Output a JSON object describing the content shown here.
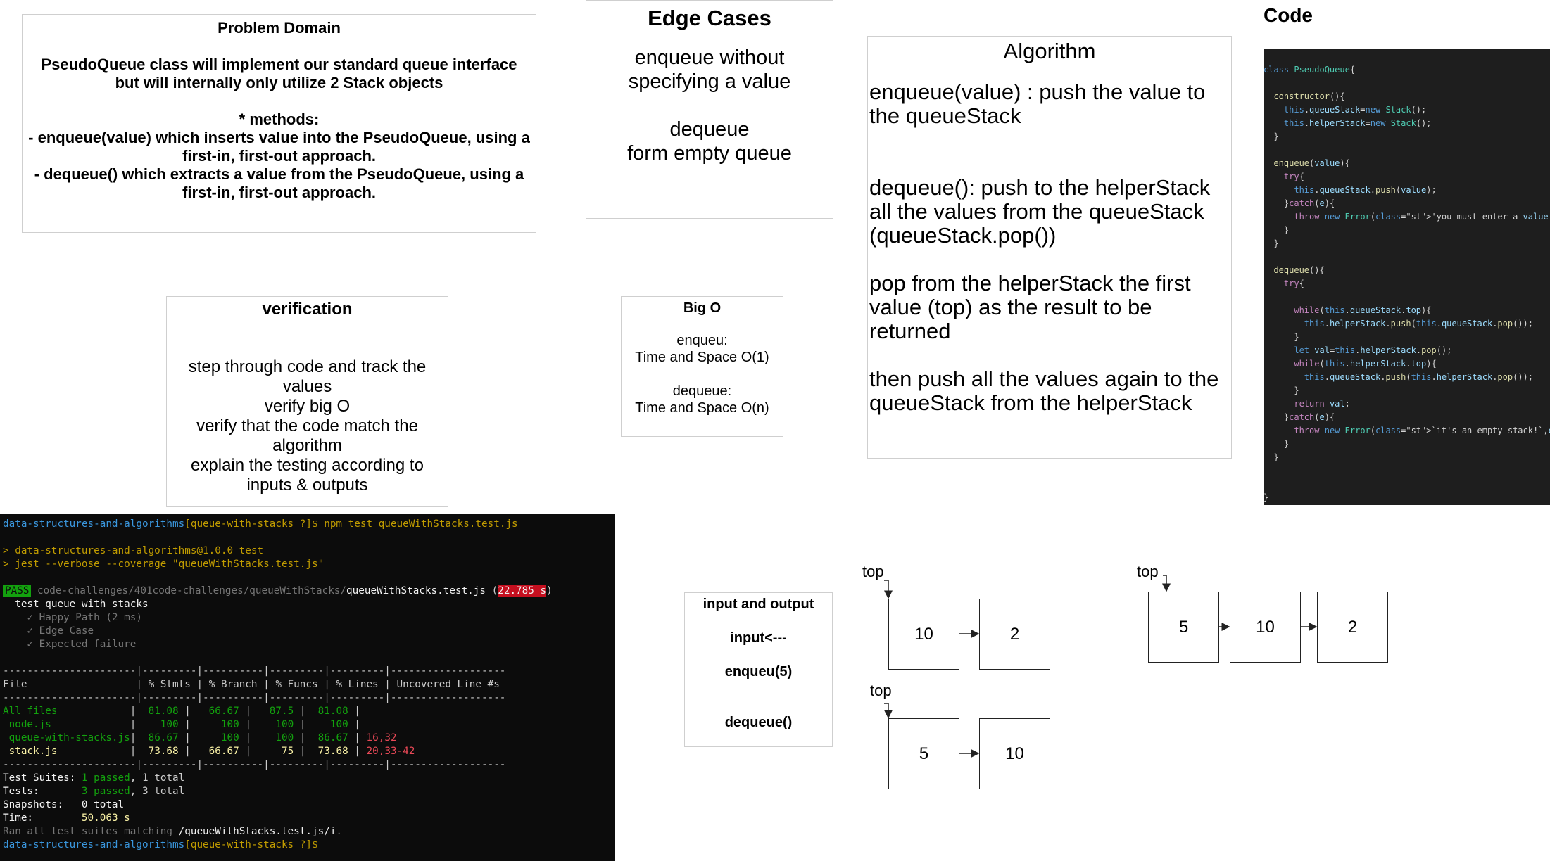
{
  "problem": {
    "title": "Problem Domain",
    "text": "PseudoQueue class will implement our standard queue interface but will internally only utilize 2 Stack objects\n\n* methods:\n - enqueue(value) which inserts value into the PseudoQueue, using a first-in, first-out approach.\n - dequeue() which extracts a value from the PseudoQueue, using a first-in, first-out approach."
  },
  "edge": {
    "title": "Edge Cases",
    "text": "enqueue without specifying a value\n\ndequeue\nform empty queue"
  },
  "algorithm": {
    "title": "Algorithm",
    "steps": [
      "enqueue(value) : push the value to the queueStack",
      "dequeue(): push to the helperStack all the values from the queueStack (queueStack.pop())",
      "pop from the helperStack the first value (top) as the result to be returned",
      "then push all the values again to the queueStack from the helperStack"
    ]
  },
  "code": {
    "title": "Code",
    "lines": [
      "class PseudoQueue{",
      "",
      "  constructor(){",
      "    this.queueStack=new Stack();",
      "    this.helperStack=new Stack();",
      "  }",
      "",
      "  enqueue(value){",
      "    try{",
      "      this.queueStack.push(value);",
      "    }catch(e){",
      "      throw new Error('you must enter a value !');",
      "    }",
      "  }",
      "",
      "  dequeue(){",
      "    try{",
      "",
      "      while(this.queueStack.top){",
      "        this.helperStack.push(this.queueStack.pop());",
      "      }",
      "      let val=this.helperStack.pop();",
      "      while(this.helperStack.top){",
      "        this.queueStack.push(this.helperStack.pop());",
      "      }",
      "      return val;",
      "    }catch(e){",
      "      throw new Error(`it's an empty stack!`,e);",
      "    }",
      "  }",
      "",
      "",
      "}"
    ]
  },
  "verification": {
    "title": "verification",
    "text": "step through code and track the values\nverify big O\nverify that the code match the algorithm\nexplain the testing according to inputs & outputs"
  },
  "bigo": {
    "title": "Big O",
    "text": "enqueu:\nTime and Space O(1)\n\ndequeue:\nTime and Space O(n)"
  },
  "io": {
    "title": "input and output",
    "input": "input<---",
    "enq": "enqueu(5)",
    "deq": "dequeue()"
  },
  "diagrams": {
    "top_label": "top",
    "d1": [
      "10",
      "2"
    ],
    "d2": [
      "5",
      "10"
    ],
    "d3": [
      "5",
      "10",
      "2"
    ]
  },
  "terminal": {
    "prompt_path": "data-structures-and-algorithms",
    "prompt_branch": "[queue-with-stacks ?]$",
    "cmd": " npm test queueWithStacks.test.js",
    "script1": "> data-structures-and-algorithms@1.0.0 test",
    "script2": "> jest --verbose --coverage \"queueWithStacks.test.js\"",
    "pass_badge": "PASS",
    "test_dir": "code-challenges/401code-challenges/queueWithStacks/",
    "test_file": "queueWithStacks.test.js",
    "duration": "22.785 s",
    "suite": "  test queue with stacks",
    "tests": [
      "    ✓ Happy Path (2 ms)",
      "    ✓ Edge Case",
      "    ✓ Expected failure"
    ],
    "coverage_sep": "----------------------|---------|----------|---------|---------|-------------------",
    "coverage_header": "File                  | % Stmts | % Branch | % Funcs | % Lines | Uncovered Line #s ",
    "coverage_rows": [
      {
        "file": "All files            ",
        "stmts": "  81.08 ",
        "branch": "   66.67 ",
        "funcs": "   87.5 ",
        "lines": "  81.08 ",
        "uncovered": "",
        "kind": "g"
      },
      {
        "file": " node.js             ",
        "stmts": "    100 ",
        "branch": "     100 ",
        "funcs": "    100 ",
        "lines": "    100 ",
        "uncovered": "",
        "kind": "g"
      },
      {
        "file": " queue-with-stacks.js",
        "stmts": "  86.67 ",
        "branch": "     100 ",
        "funcs": "    100 ",
        "lines": "  86.67 ",
        "uncovered": " 16,32",
        "kind": "g"
      },
      {
        "file": " stack.js            ",
        "stmts": "  73.68 ",
        "branch": "   66.67 ",
        "funcs": "     75 ",
        "lines": "  73.68 ",
        "uncovered": " 20,33-42",
        "kind": "y"
      }
    ],
    "summary": {
      "suites_label": "Test Suites: ",
      "suites_pass": "1 passed",
      "suites_total": ", 1 total",
      "tests_label": "Tests:       ",
      "tests_pass": "3 passed",
      "tests_total": ", 3 total",
      "snap": "Snapshots:   0 total",
      "time_label": "Time:        ",
      "time_val": "50.063 s",
      "ran": "Ran all test suites matching ",
      "ran_pattern": "/queueWithStacks.test.js/i",
      "ran_end": "."
    }
  }
}
